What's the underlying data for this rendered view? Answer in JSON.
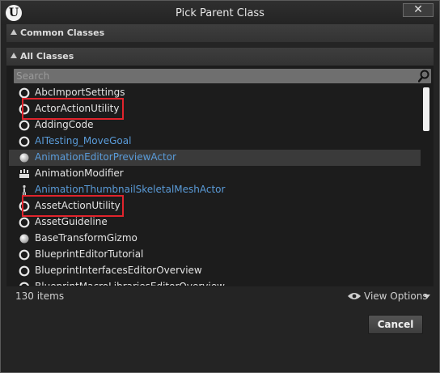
{
  "window": {
    "title": "Pick Parent Class",
    "close_symbol": "✕"
  },
  "common_classes": {
    "label": "Common Classes"
  },
  "all_classes": {
    "label": "All Classes",
    "search": {
      "placeholder": "Search",
      "value": ""
    },
    "items": [
      {
        "label": "AbcImportSettings",
        "icon": "class-icon",
        "style": "native"
      },
      {
        "label": "ActorActionUtility",
        "icon": "class-icon",
        "style": "native"
      },
      {
        "label": "AddingCode",
        "icon": "class-icon",
        "style": "native"
      },
      {
        "label": "AITesting_MoveGoal",
        "icon": "class-icon",
        "style": "blueprint"
      },
      {
        "label": "AnimationEditorPreviewActor",
        "icon": "sphere-icon",
        "style": "blueprint"
      },
      {
        "label": "AnimationModifier",
        "icon": "modifier-icon",
        "style": "native"
      },
      {
        "label": "AnimationThumbnailSkeletalMeshActor",
        "icon": "skeletal-mesh-icon",
        "style": "blueprint"
      },
      {
        "label": "AssetActionUtility",
        "icon": "class-icon",
        "style": "native"
      },
      {
        "label": "AssetGuideline",
        "icon": "class-icon",
        "style": "native"
      },
      {
        "label": "BaseTransformGizmo",
        "icon": "sphere-icon",
        "style": "native"
      },
      {
        "label": "BlueprintEditorTutorial",
        "icon": "class-icon",
        "style": "native"
      },
      {
        "label": "BlueprintInterfacesEditorOverview",
        "icon": "class-icon",
        "style": "native"
      },
      {
        "label": "BlueprintMacroLibrariesEditorOverview",
        "icon": "class-icon",
        "style": "native"
      }
    ],
    "selected_item": "AnimationEditorPreviewActor",
    "highlighted_items": [
      "ActorActionUtility",
      "AssetActionUtility"
    ]
  },
  "footer": {
    "item_count": "130 items",
    "view_options": "View Options"
  },
  "buttons": {
    "cancel": "Cancel"
  },
  "colors": {
    "blueprint_text": "#5a9bd8",
    "highlight_box": "#e0242c",
    "selected_row": "#3a3a3a"
  }
}
